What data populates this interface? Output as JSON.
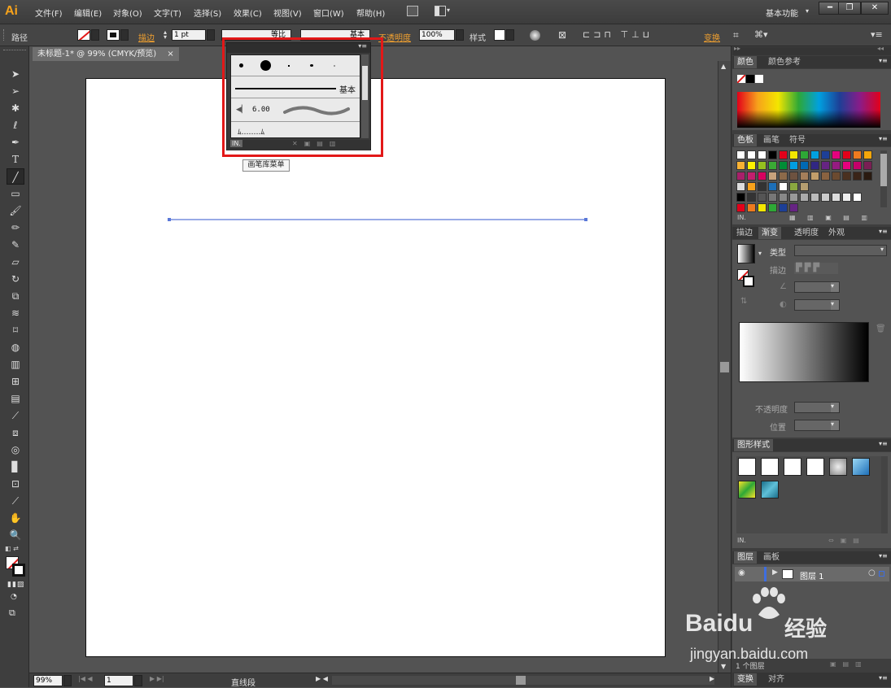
{
  "app": {
    "logo": "Ai",
    "workspace": "基本功能"
  },
  "menu": [
    "文件(F)",
    "编辑(E)",
    "对象(O)",
    "文字(T)",
    "选择(S)",
    "效果(C)",
    "视图(V)",
    "窗口(W)",
    "帮助(H)"
  ],
  "control": {
    "selection_label": "路径",
    "stroke_label": "描边",
    "stroke_weight": "1 pt",
    "profile": "等比",
    "brush": "基本",
    "opacity_label": "不透明度",
    "opacity": "100%",
    "style_label": "样式",
    "transform_label": "变换"
  },
  "document": {
    "tab_title": "未标题-1* @ 99% (CMYK/预览)",
    "close": "×"
  },
  "brush_panel": {
    "brush_name": "基本",
    "brush_size": "6.00",
    "tooltip": "画笔库菜单"
  },
  "status": {
    "zoom": "99%",
    "page": "1",
    "mode": "直线段"
  },
  "panels": {
    "color": {
      "tabs": [
        "颜色",
        "颜色参考"
      ]
    },
    "swatches": {
      "tabs": [
        "色板",
        "画笔",
        "符号"
      ]
    },
    "gradient": {
      "tabs": [
        "描边",
        "渐变",
        "透明度",
        "外观"
      ],
      "type_label": "类型",
      "stroke_label": "描边",
      "opacity_label": "不透明度",
      "location_label": "位置"
    },
    "graphic_styles": {
      "title": "图形样式"
    },
    "layers": {
      "tabs": [
        "图层",
        "画板"
      ],
      "layer_name": "图层 1",
      "count": "1 个图层"
    },
    "transform": {
      "tabs": [
        "变换",
        "对齐"
      ]
    }
  },
  "watermark": {
    "brand": "Baidu",
    "product": "经验",
    "url": "jingyan.baidu.com"
  },
  "colors": {
    "accent": "#f7a21b",
    "highlight": "#e21818",
    "path": "#5a78d8"
  }
}
